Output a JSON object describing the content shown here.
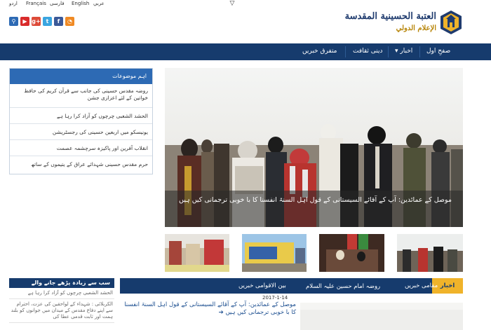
{
  "languages": [
    "عربي",
    "English",
    "فارسی",
    "Français",
    "اردو"
  ],
  "social_icons": [
    {
      "name": "search-icon",
      "glyph": "⚲",
      "color": "#2d6ab4"
    },
    {
      "name": "youtube-icon",
      "glyph": "▶",
      "color": "#d92b2b"
    },
    {
      "name": "google-plus-icon",
      "glyph": "g+",
      "color": "#dd4b39"
    },
    {
      "name": "twitter-icon",
      "glyph": "t",
      "color": "#3aa5e0"
    },
    {
      "name": "facebook-icon",
      "glyph": "f",
      "color": "#3b5998"
    },
    {
      "name": "rss-icon",
      "glyph": "◔",
      "color": "#f08a24"
    }
  ],
  "logo": {
    "line1": "العتبة الحسينية المقدسة",
    "line2": "الإعلام الدولي"
  },
  "nav": {
    "home": "صفحِ اول",
    "news": "اخبار",
    "news_caret": "▾",
    "culture": "دینی ثقافت",
    "misc": "متفرق خبریں"
  },
  "sidebar": {
    "heading": "اہم موضوعات",
    "items": [
      "روضہ مقدس حسینی کی جانب سے قرآن کریم کی حافظ خواتین کے لئے اعزازی جشن",
      "الحشد الشعبی چرچوں کو آزاد کرا رہا ہے",
      "یونیسکو میں اربعین حسینی کی رجسٹریشن",
      "انقلاب آفرین اور پاکیزہ سرچشمہ عصمت",
      "حرم مقدس حسینی شہدائے عراق کے یتیموں کے ساتھ"
    ]
  },
  "hero": {
    "caption": "موصل کے عمائدین: آپ کے آقائے السیستانی کے قول اہل السنۃ انفسنا کا با خوبی ترجمانی کیں ہیں"
  },
  "most_read": {
    "heading": "سب سے زیادہ پڑھے جانے والے",
    "items": [
      "الحشد الشعبی چرچوں کو آزاد کرا رہا ہے",
      "الکربلائی : شہداء کے لواحقین کی عزت، احترام سے اپنے دفاع مقدس کے میدان میں جوانوں کو بلند ہمت اور ثابت قدمی عطا کی"
    ]
  },
  "news_tabs": {
    "active": "اخبار",
    "local": "مقامی خبریں",
    "shrine": "روضہ امام حسین علیہ السلام",
    "intl": "بین الاقوامی خبریں"
  },
  "latest_news": {
    "date": "2017-1-14",
    "title": "موصل کے عمائدین: آپ کے آقائے السیستانی کے قول اہل السنۃ انفسنا کا با خوبی ترجمانی کیں ہیں"
  },
  "colors": {
    "navy": "#163b6d",
    "blue": "#2d6ab4",
    "gold": "#f0b32a",
    "link": "#1a4d8f"
  }
}
